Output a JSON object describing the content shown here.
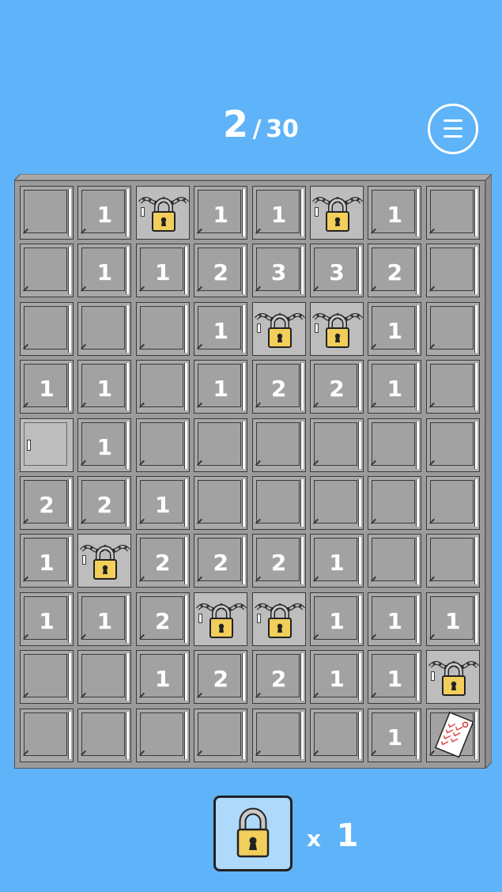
{
  "header": {
    "level_current": "2",
    "level_separator": "/",
    "level_total": "30"
  },
  "board": {
    "rows": [
      [
        {
          "t": "empty"
        },
        {
          "t": "num",
          "v": "1"
        },
        {
          "t": "lock"
        },
        {
          "t": "num",
          "v": "1"
        },
        {
          "t": "num",
          "v": "1"
        },
        {
          "t": "lock"
        },
        {
          "t": "num",
          "v": "1"
        },
        {
          "t": "empty"
        }
      ],
      [
        {
          "t": "empty"
        },
        {
          "t": "num",
          "v": "1"
        },
        {
          "t": "num",
          "v": "1"
        },
        {
          "t": "num",
          "v": "2"
        },
        {
          "t": "num",
          "v": "3"
        },
        {
          "t": "num",
          "v": "3"
        },
        {
          "t": "num",
          "v": "2"
        },
        {
          "t": "empty"
        }
      ],
      [
        {
          "t": "empty"
        },
        {
          "t": "empty"
        },
        {
          "t": "empty"
        },
        {
          "t": "num",
          "v": "1"
        },
        {
          "t": "lock"
        },
        {
          "t": "lock"
        },
        {
          "t": "num",
          "v": "1"
        },
        {
          "t": "empty"
        }
      ],
      [
        {
          "t": "num",
          "v": "1"
        },
        {
          "t": "num",
          "v": "1"
        },
        {
          "t": "empty"
        },
        {
          "t": "num",
          "v": "1"
        },
        {
          "t": "num",
          "v": "2"
        },
        {
          "t": "num",
          "v": "2"
        },
        {
          "t": "num",
          "v": "1"
        },
        {
          "t": "empty"
        }
      ],
      [
        {
          "t": "closed"
        },
        {
          "t": "num",
          "v": "1"
        },
        {
          "t": "empty"
        },
        {
          "t": "empty"
        },
        {
          "t": "empty"
        },
        {
          "t": "empty"
        },
        {
          "t": "empty"
        },
        {
          "t": "empty"
        }
      ],
      [
        {
          "t": "num",
          "v": "2"
        },
        {
          "t": "num",
          "v": "2"
        },
        {
          "t": "num",
          "v": "1"
        },
        {
          "t": "empty"
        },
        {
          "t": "empty"
        },
        {
          "t": "empty"
        },
        {
          "t": "empty"
        },
        {
          "t": "empty"
        }
      ],
      [
        {
          "t": "num",
          "v": "1"
        },
        {
          "t": "lock"
        },
        {
          "t": "num",
          "v": "2"
        },
        {
          "t": "num",
          "v": "2"
        },
        {
          "t": "num",
          "v": "2"
        },
        {
          "t": "num",
          "v": "1"
        },
        {
          "t": "empty"
        },
        {
          "t": "empty"
        }
      ],
      [
        {
          "t": "num",
          "v": "1"
        },
        {
          "t": "num",
          "v": "1"
        },
        {
          "t": "num",
          "v": "2"
        },
        {
          "t": "lock"
        },
        {
          "t": "lock"
        },
        {
          "t": "num",
          "v": "1"
        },
        {
          "t": "num",
          "v": "1"
        },
        {
          "t": "num",
          "v": "1"
        }
      ],
      [
        {
          "t": "empty"
        },
        {
          "t": "empty"
        },
        {
          "t": "num",
          "v": "1"
        },
        {
          "t": "num",
          "v": "2"
        },
        {
          "t": "num",
          "v": "2"
        },
        {
          "t": "num",
          "v": "1"
        },
        {
          "t": "num",
          "v": "1"
        },
        {
          "t": "lock"
        }
      ],
      [
        {
          "t": "empty"
        },
        {
          "t": "empty"
        },
        {
          "t": "empty"
        },
        {
          "t": "empty"
        },
        {
          "t": "empty"
        },
        {
          "t": "empty"
        },
        {
          "t": "num",
          "v": "1"
        },
        {
          "t": "note"
        }
      ]
    ]
  },
  "inventory": {
    "item_icon": "padlock-icon",
    "multiplier": "x",
    "count": "1"
  },
  "colors": {
    "background": "#5EB3F9",
    "lock_gold": "#F2CE5A",
    "cell_gray": "#A9A9A9"
  }
}
